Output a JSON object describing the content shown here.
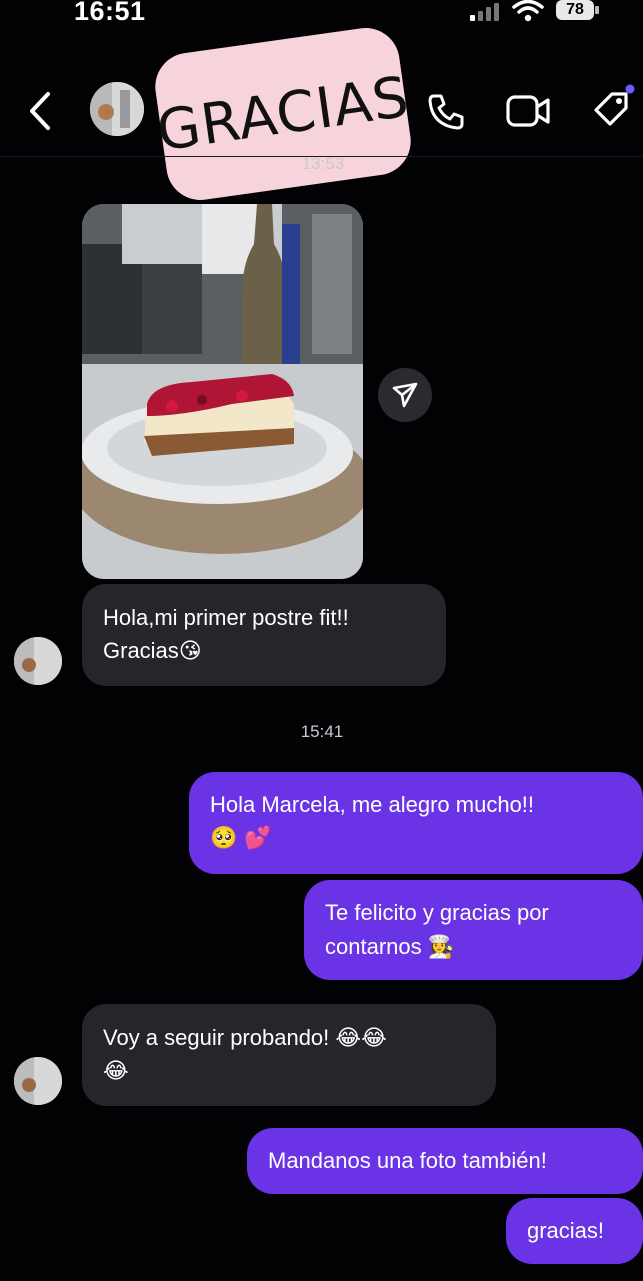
{
  "status_bar": {
    "time": "16:51",
    "battery": "78"
  },
  "sticker": {
    "text": "GRACIAS"
  },
  "timestamps": {
    "first": "13:53",
    "second": "15:41"
  },
  "messages": {
    "incoming_1": {
      "line1": "Hola,mi primer postre fit!!",
      "line2": "Gracias",
      "emoji": "😘"
    },
    "outgoing_1": {
      "line1": "Hola Marcela, me alegro mucho!!",
      "emoji": "🥺 💕"
    },
    "outgoing_2": {
      "line1": "Te felicito y gracias por",
      "line2": "contarnos",
      "emoji": "👩‍🍳"
    },
    "incoming_2": {
      "line1": "Voy a seguir probando!",
      "emoji1": "😂😂",
      "emoji2": "😂"
    },
    "outgoing_3": {
      "text": "Mandanos una foto también!"
    },
    "outgoing_4": {
      "text": "gracias!"
    }
  },
  "icons": [
    "back-icon",
    "phone-icon",
    "video-icon",
    "tag-icon",
    "share-icon",
    "wifi-icon",
    "signal-icon"
  ],
  "colors": {
    "outgoing_bubble": "#6a34e6",
    "incoming_bubble": "#25252a",
    "background": "#020204"
  }
}
